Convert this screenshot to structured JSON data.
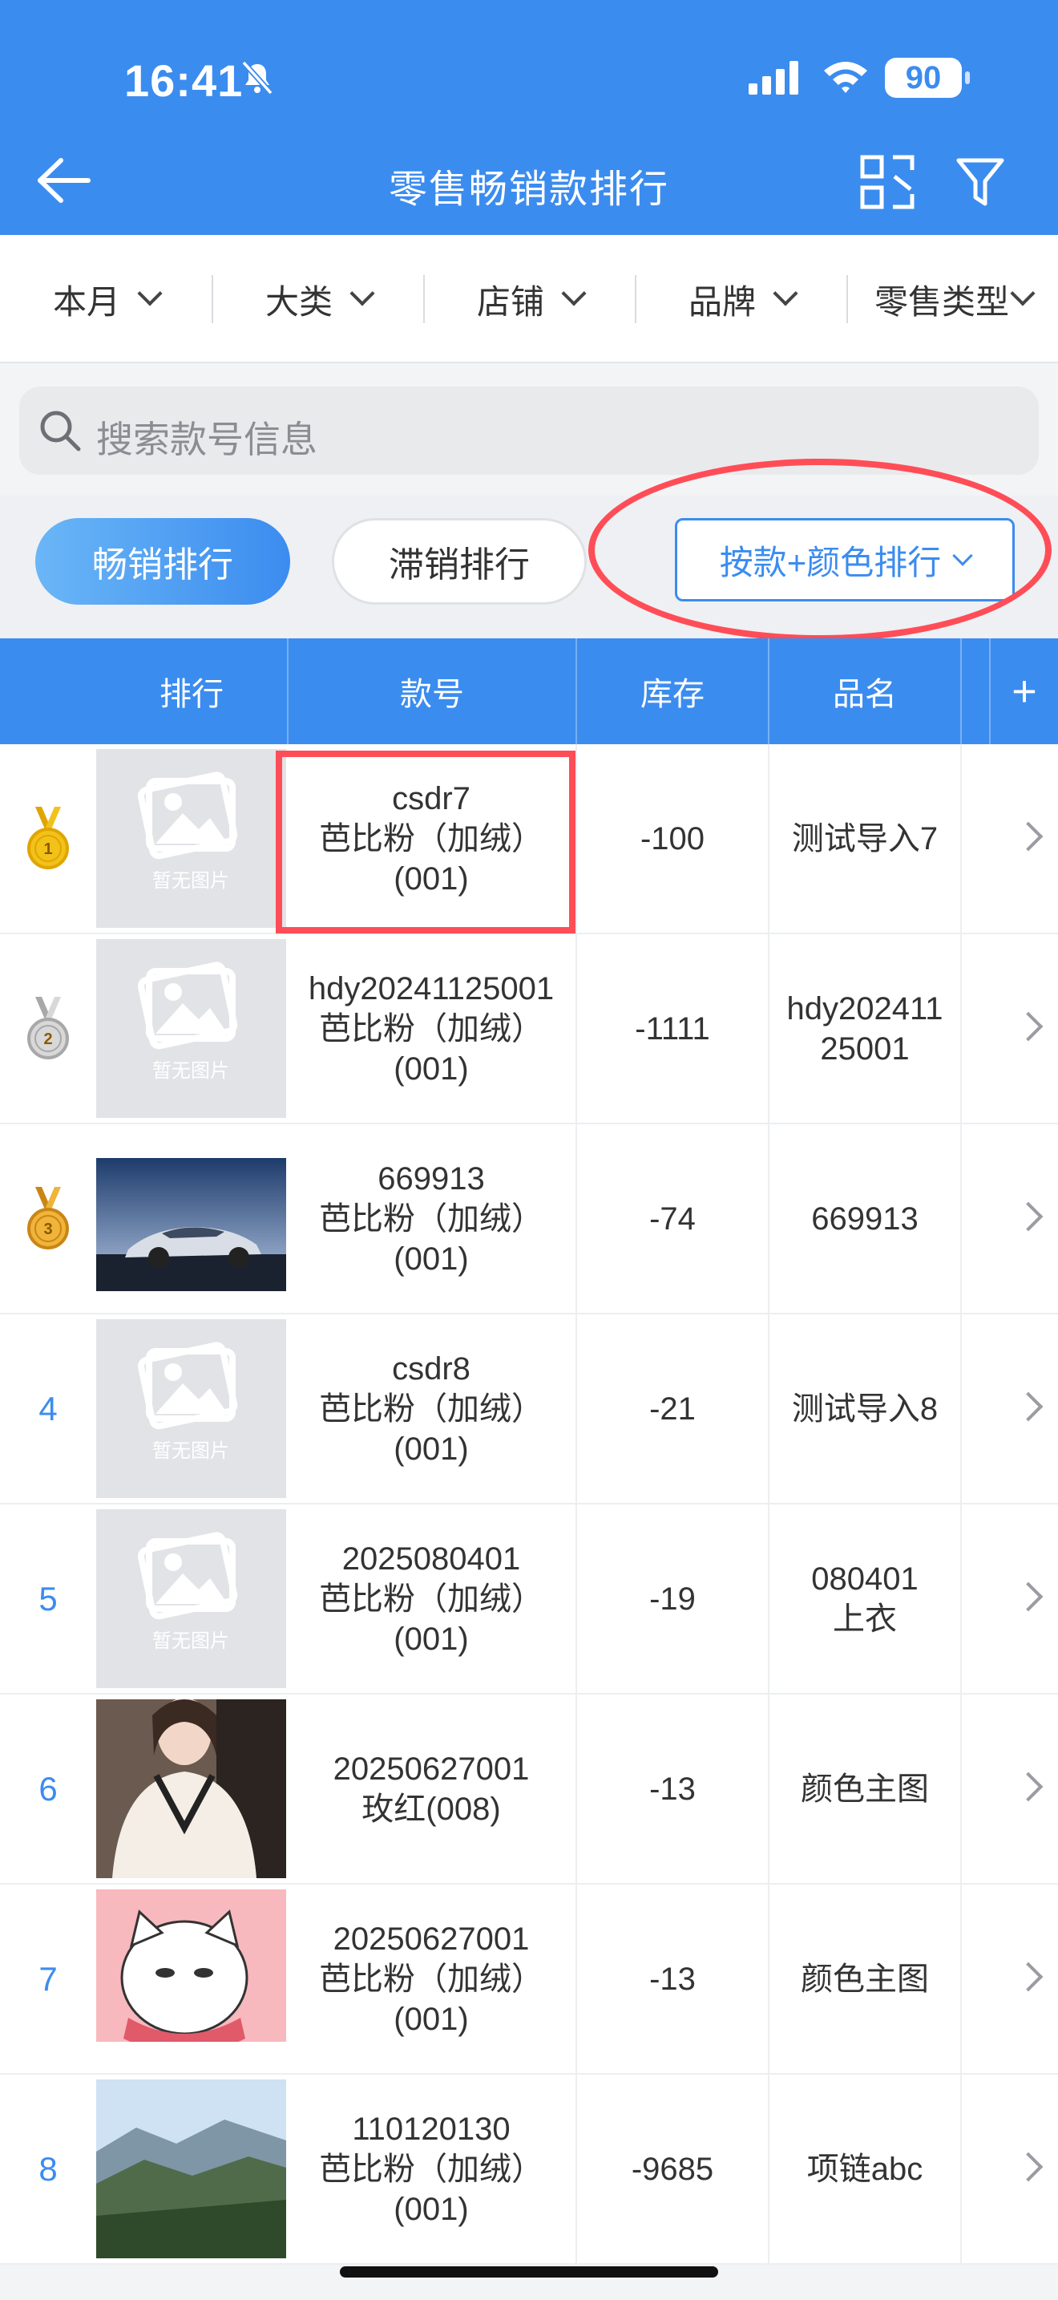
{
  "status_bar": {
    "time": "16:41",
    "battery": "90"
  },
  "nav": {
    "title": "零售畅销款排行"
  },
  "filters": [
    {
      "label": "本月"
    },
    {
      "label": "大类"
    },
    {
      "label": "店铺"
    },
    {
      "label": "品牌"
    },
    {
      "label": "零售类型"
    }
  ],
  "search": {
    "placeholder": "搜索款号信息"
  },
  "tabs": {
    "active": "畅销排行",
    "other": "滞销排行",
    "sort_select": "按款+颜色排行"
  },
  "table": {
    "headers": [
      "排行",
      "款号",
      "库存",
      "品名"
    ],
    "plus_label": "+",
    "no_image_text": "暂无图片",
    "rows": [
      {
        "rank": "1",
        "medal": "gold",
        "image": "placeholder",
        "code": "csdr7",
        "color": "芭比粉（加绒）",
        "color_code": "(001)",
        "stock": "-100",
        "name": "测试导入7"
      },
      {
        "rank": "2",
        "medal": "silver",
        "image": "placeholder",
        "code": "hdy20241125001",
        "color": "芭比粉（加绒）",
        "color_code": "(001)",
        "stock": "-1111",
        "name": "hdy20241125001"
      },
      {
        "rank": "3",
        "medal": "bronze",
        "image": "car",
        "code": "669913",
        "color": "芭比粉（加绒）",
        "color_code": "(001)",
        "stock": "-74",
        "name": "669913"
      },
      {
        "rank": "4",
        "medal": "",
        "image": "placeholder",
        "code": "csdr8",
        "color": "芭比粉（加绒）",
        "color_code": "(001)",
        "stock": "-21",
        "name": "测试导入8"
      },
      {
        "rank": "5",
        "medal": "",
        "image": "placeholder",
        "code": "2025080401",
        "color": "芭比粉（加绒）",
        "color_code": "(001)",
        "stock": "-19",
        "name": "080401上衣"
      },
      {
        "rank": "6",
        "medal": "",
        "image": "sweater",
        "code": "20250627001",
        "color": "玫红(008)",
        "color_code": "",
        "stock": "-13",
        "name": "颜色主图"
      },
      {
        "rank": "7",
        "medal": "",
        "image": "cartoon-cat",
        "code": "20250627001",
        "color": "芭比粉（加绒）",
        "color_code": "(001)",
        "stock": "-13",
        "name": "颜色主图"
      },
      {
        "rank": "8",
        "medal": "",
        "image": "mountain",
        "code": "110120130",
        "color": "芭比粉（加绒）",
        "color_code": "(001)",
        "stock": "-9685",
        "name": "项链abc"
      }
    ]
  },
  "colors": {
    "primary": "#3b8cef",
    "highlight": "#ff4d57"
  }
}
